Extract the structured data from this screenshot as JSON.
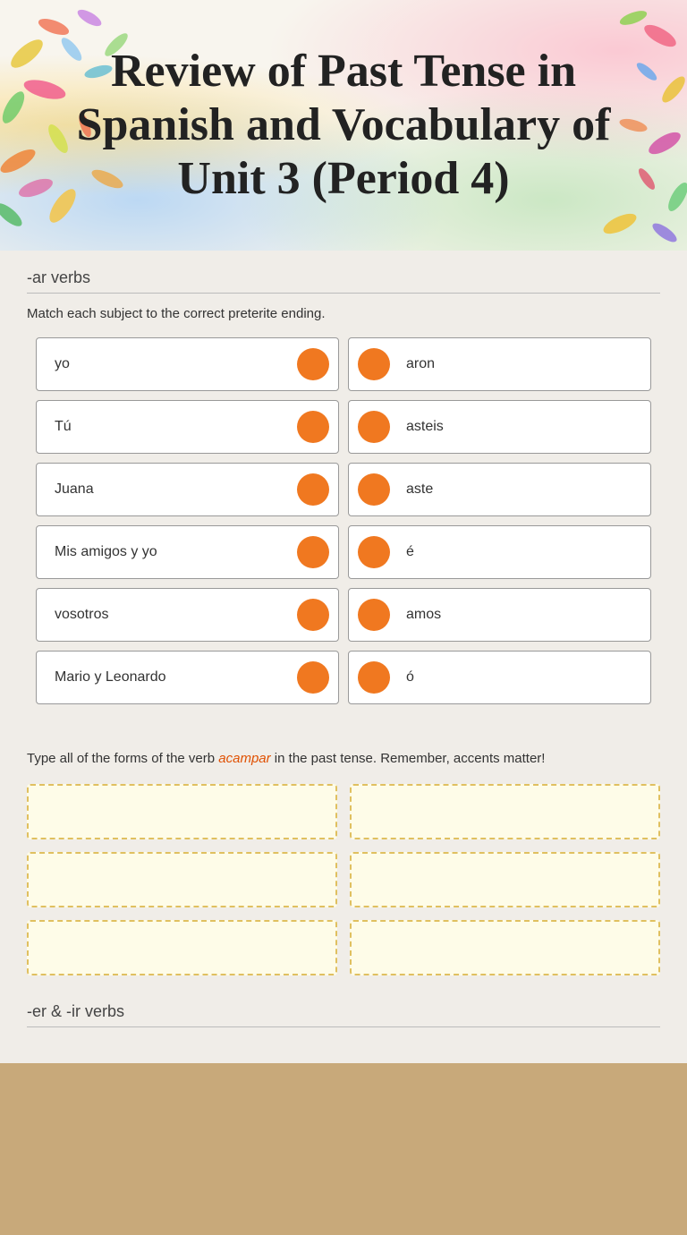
{
  "header": {
    "title": "Review of Past Tense in Spanish and Vocabulary of Unit 3 (Period 4)"
  },
  "ar_verbs_section": {
    "heading": "-ar verbs",
    "instruction": "Match each subject to the correct preterite ending.",
    "left_items": [
      {
        "id": "left-1",
        "label": "yo"
      },
      {
        "id": "left-2",
        "label": "Tú"
      },
      {
        "id": "left-3",
        "label": "Juana"
      },
      {
        "id": "left-4",
        "label": "Mis amigos y yo"
      },
      {
        "id": "left-5",
        "label": "vosotros"
      },
      {
        "id": "left-6",
        "label": "Mario y Leonardo"
      }
    ],
    "right_items": [
      {
        "id": "right-1",
        "label": "aron"
      },
      {
        "id": "right-2",
        "label": "asteis"
      },
      {
        "id": "right-3",
        "label": "aste"
      },
      {
        "id": "right-4",
        "label": "é"
      },
      {
        "id": "right-5",
        "label": "amos"
      },
      {
        "id": "right-6",
        "label": "ó"
      }
    ]
  },
  "verb_forms_section": {
    "instruction_before": "Type all of the forms of the verb ",
    "verb": "acampar",
    "instruction_after": " in the past tense. Remember, accents matter!",
    "inputs": [
      "",
      "",
      "",
      "",
      "",
      ""
    ]
  },
  "er_ir_section": {
    "heading": "-er & -ir verbs"
  }
}
